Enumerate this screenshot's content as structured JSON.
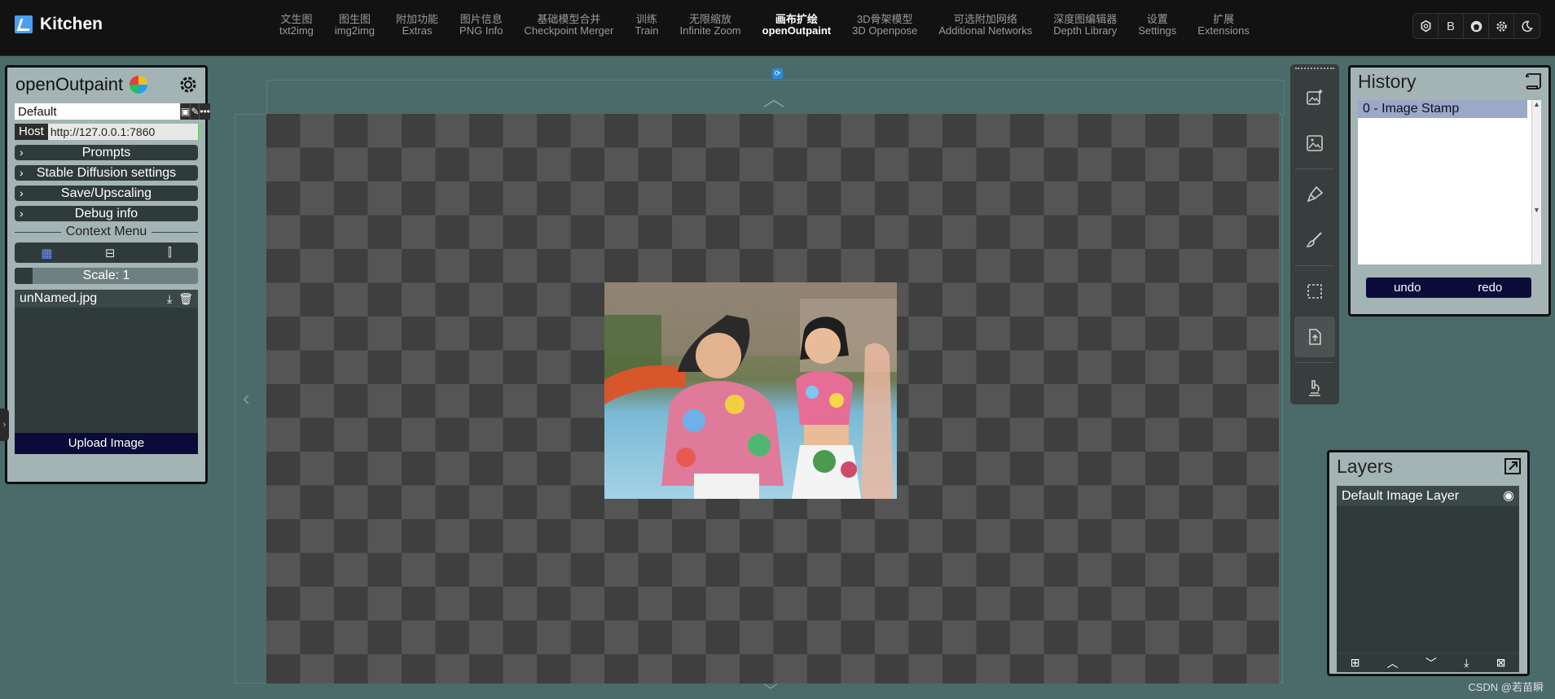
{
  "app": {
    "title": "Kitchen"
  },
  "nav": [
    {
      "zh": "文生图",
      "en": "txt2img"
    },
    {
      "zh": "图生图",
      "en": "img2img"
    },
    {
      "zh": "附加功能",
      "en": "Extras"
    },
    {
      "zh": "图片信息",
      "en": "PNG Info"
    },
    {
      "zh": "基础模型合并",
      "en": "Checkpoint Merger"
    },
    {
      "zh": "训练",
      "en": "Train"
    },
    {
      "zh": "无限缩放",
      "en": "Infinite Zoom"
    },
    {
      "zh": "画布扩绘",
      "en": "openOutpaint"
    },
    {
      "zh": "3D骨架模型",
      "en": "3D Openpose"
    },
    {
      "zh": "可选附加网络",
      "en": "Additional Networks"
    },
    {
      "zh": "深度图编辑器",
      "en": "Depth Library"
    },
    {
      "zh": "设置",
      "en": "Settings"
    },
    {
      "zh": "扩展",
      "en": "Extensions"
    }
  ],
  "active_tab": "openOutpaint",
  "top_icons": [
    "openai-icon",
    "b-icon",
    "github-icon",
    "settings-icon",
    "moon-icon"
  ],
  "top_icon_b": "B",
  "left_panel": {
    "title": "openOutpaint",
    "preset": "Default",
    "host_label": "Host",
    "host_value": "http://127.0.0.1:7860",
    "sections": [
      "Prompts",
      "Stable Diffusion settings",
      "Save/Upscaling",
      "Debug info"
    ],
    "context_menu": "Context Menu",
    "scale": "Scale: 1",
    "file_name": "unNamed.jpg",
    "upload": "Upload Image"
  },
  "history": {
    "title": "History",
    "items": [
      "0 - Image Stamp"
    ],
    "undo": "undo",
    "redo": "redo"
  },
  "layers": {
    "title": "Layers",
    "items": [
      "Default Image Layer"
    ]
  },
  "watermark": "CSDN @若苗瞬",
  "colors": {
    "accent": "#0b0b3a",
    "panel": "#a4b4b4",
    "background": "#4b6b6a",
    "host_ok": "#4cd84c"
  }
}
